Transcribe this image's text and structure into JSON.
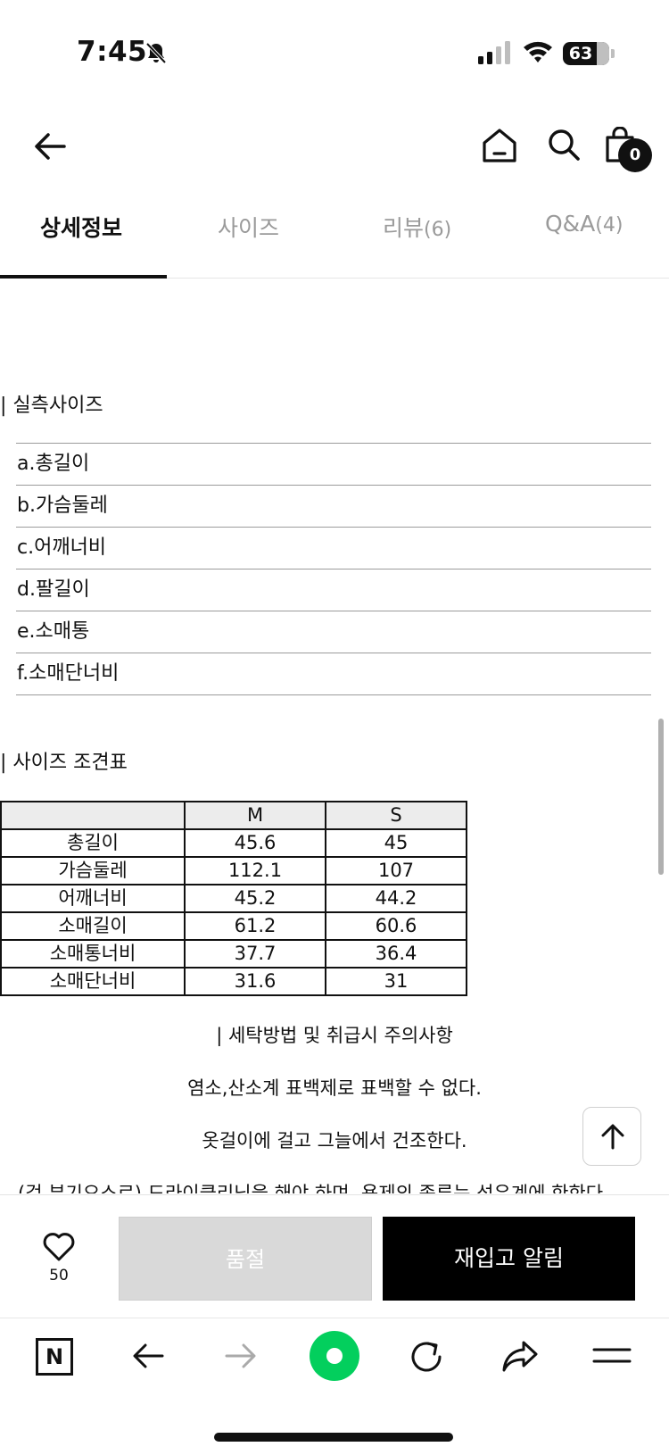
{
  "status_bar": {
    "time": "7:45",
    "battery": "63",
    "icons": [
      "bell-muted-icon",
      "signal-icon",
      "wifi-icon",
      "battery-icon"
    ]
  },
  "header": {
    "icons": [
      "back-arrow-icon",
      "home-icon",
      "search-icon",
      "cart-icon"
    ],
    "cart_count": "0"
  },
  "tabs": [
    {
      "label": "상세정보",
      "count": "",
      "active": true
    },
    {
      "label": "사이즈",
      "count": "",
      "active": false
    },
    {
      "label": "리뷰",
      "count": "(6)",
      "active": false
    },
    {
      "label": "Q&A",
      "count": "(4)",
      "active": false
    }
  ],
  "measurements": {
    "title": "| 실측사이즈",
    "items": [
      "a.총길이",
      "b.가슴둘레",
      "c.어깨너비",
      "d.팔길이",
      "e.소매통",
      "f.소매단너비"
    ]
  },
  "size_table": {
    "title": "| 사이즈 조견표",
    "headers": [
      "",
      "M",
      "S"
    ],
    "rows": [
      [
        "총길이",
        "45.6",
        "45"
      ],
      [
        "가슴둘레",
        "112.1",
        "107"
      ],
      [
        "어깨너비",
        "45.2",
        "44.2"
      ],
      [
        "소매길이",
        "61.2",
        "60.6"
      ],
      [
        "소매통너비",
        "37.7",
        "36.4"
      ],
      [
        "소매단너비",
        "31.6",
        "31"
      ]
    ]
  },
  "care": {
    "title": "| 세탁방법 및 취급시 주의사항",
    "lines": [
      "염소,산소계 표백제로 표백할 수 없다.",
      "옷걸이에 걸고 그늘에서 건조한다.",
      "(겉 부기요소로) 드라이클리닝을 해야 하며, 용제의 종류는 석유계에 한한다"
    ]
  },
  "action_bar": {
    "like_count": "50",
    "soldout_label": "품절",
    "restock_label": "재입고 알림"
  },
  "browser_bar": {
    "n_label": "N",
    "icons": [
      "back-arrow-icon",
      "forward-arrow-icon",
      "green-dot-icon",
      "refresh-icon",
      "share-icon",
      "menu-icon"
    ]
  },
  "colors": {
    "accent_green": "#03cf5d",
    "restock_button": "#000000",
    "soldout_button": "#d9d9d9",
    "tab_inactive": "#9a9a9a"
  }
}
